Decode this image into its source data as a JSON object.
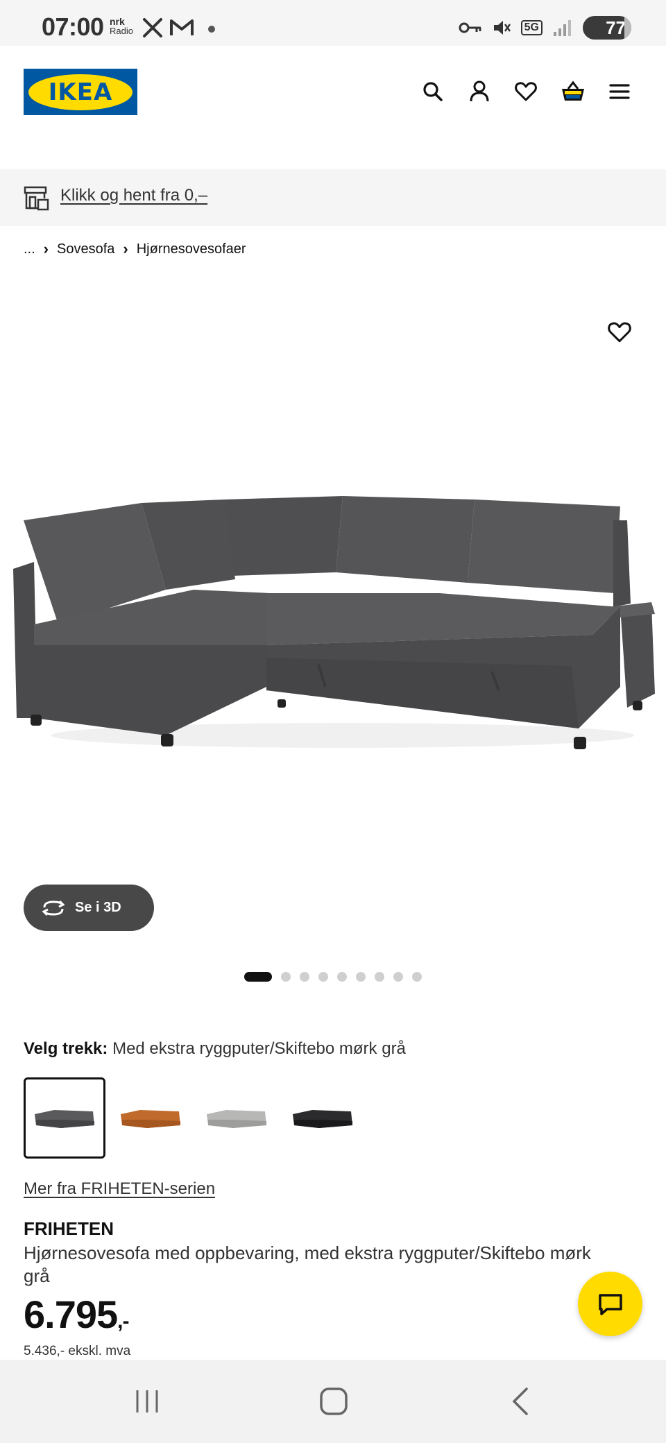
{
  "status_bar": {
    "time": "07:00",
    "nrk_label": "nrk",
    "radio_label": "Radio",
    "network": "5G",
    "battery": "77"
  },
  "header": {
    "logo_text": "IKEA",
    "icons": [
      "search-icon",
      "account-icon",
      "heart-icon",
      "basket-icon",
      "menu-icon"
    ]
  },
  "banner": {
    "text": "Klikk og hent fra 0,–"
  },
  "breadcrumb": {
    "ellipsis": "...",
    "items": [
      "Sovesofa",
      "Hjørnesovesofaer"
    ]
  },
  "gallery": {
    "view_3d_label": "Se i 3D",
    "dot_count": 9,
    "active_dot": 0
  },
  "cover": {
    "label": "Velg trekk:",
    "value": "Med ekstra ryggputer/Skiftebo mørk grå",
    "swatch_colors": [
      "#5a5a5c",
      "#c06a2c",
      "#b7b8b6",
      "#2b2b2d"
    ],
    "selected_index": 0
  },
  "product": {
    "series_link": "Mer fra FRIHETEN-serien",
    "name": "FRIHETEN",
    "description": "Hjørnesovesofa med oppbevaring, med ekstra ryggputer/Skiftebo mørk grå",
    "price": "6.795",
    "price_suffix": ",-",
    "price_ex_vat": "5.436,- ekskl. mva"
  },
  "colors": {
    "brand_blue": "#0058a3",
    "brand_yellow": "#ffdb00"
  }
}
